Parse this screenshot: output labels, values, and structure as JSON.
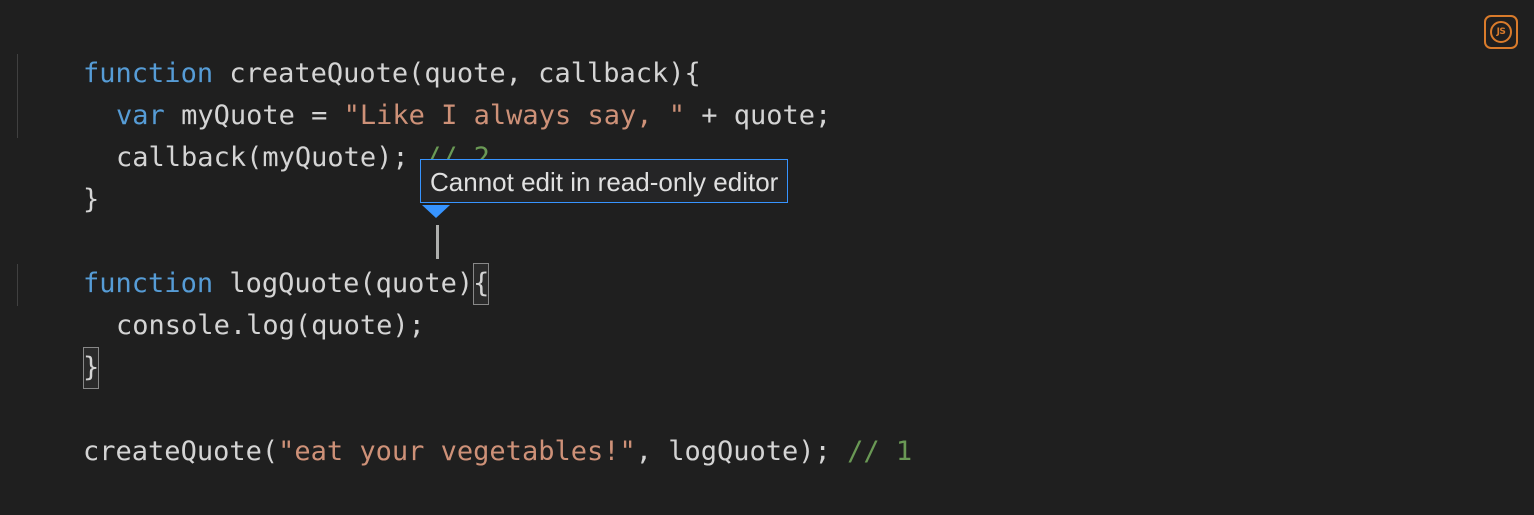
{
  "editor": {
    "language_icon": "nodejs-icon",
    "language_icon_text": "JS",
    "lines": [
      {
        "tokens": [
          {
            "t": "kw",
            "v": "function"
          },
          {
            "t": "plain",
            "v": " createQuote(quote, callback){"
          }
        ]
      },
      {
        "tokens": [
          {
            "t": "kw",
            "v": "var"
          },
          {
            "t": "plain",
            "v": " myQuote = "
          },
          {
            "t": "str",
            "v": "\"Like I always say, \""
          },
          {
            "t": "plain",
            "v": " + quote;"
          }
        ]
      },
      {
        "tokens": [
          {
            "t": "plain",
            "v": "callback(myQuote); "
          },
          {
            "t": "cmt",
            "v": "// 2"
          }
        ]
      },
      {
        "tokens": [
          {
            "t": "plain",
            "v": "}"
          }
        ]
      },
      {
        "tokens": []
      },
      {
        "tokens": [
          {
            "t": "kw",
            "v": "function"
          },
          {
            "t": "plain",
            "v": " logQuote(quote)"
          },
          {
            "t": "plain",
            "v": "{"
          }
        ]
      },
      {
        "tokens": [
          {
            "t": "plain",
            "v": "console.log(quote);"
          }
        ]
      },
      {
        "tokens": [
          {
            "t": "plain",
            "v": "}"
          }
        ]
      },
      {
        "tokens": []
      },
      {
        "tokens": [
          {
            "t": "plain",
            "v": "createQuote("
          },
          {
            "t": "str",
            "v": "\"eat your vegetables!\""
          },
          {
            "t": "plain",
            "v": ", logQuote); "
          },
          {
            "t": "cmt",
            "v": "// 1"
          }
        ]
      }
    ]
  },
  "tooltip": {
    "message": "Cannot edit in read-only editor"
  },
  "colors": {
    "background": "#1f1f1f",
    "keyword": "#569cd6",
    "string": "#ce9178",
    "comment": "#6a9955",
    "text": "#d4d4d4",
    "tooltip_border": "#3794ff",
    "icon_accent": "#d97b2b"
  }
}
